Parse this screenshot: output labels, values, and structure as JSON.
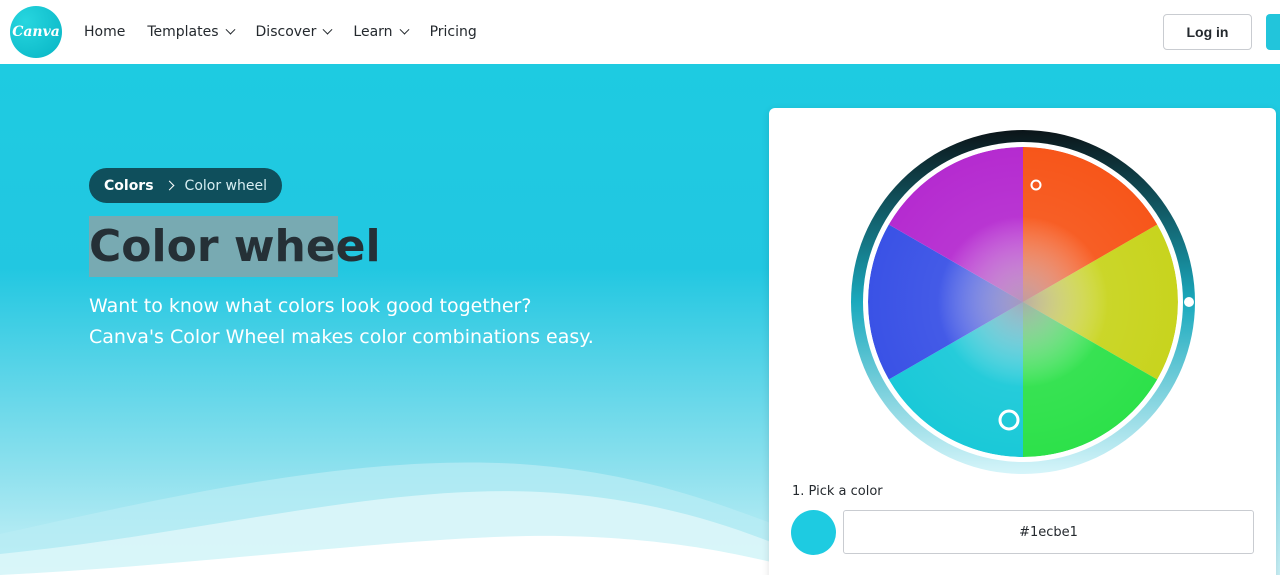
{
  "header": {
    "logo_text": "Canva",
    "nav": [
      {
        "label": "Home",
        "has_menu": false
      },
      {
        "label": "Templates",
        "has_menu": true
      },
      {
        "label": "Discover",
        "has_menu": true
      },
      {
        "label": "Learn",
        "has_menu": true
      },
      {
        "label": "Pricing",
        "has_menu": false
      }
    ],
    "login_label": "Log in"
  },
  "hero": {
    "breadcrumb": {
      "parent": "Colors",
      "current": "Color wheel"
    },
    "title": "Color wheel",
    "subtitle_line1": "Want to know what colors look good together?",
    "subtitle_line2": "Canva's Color Wheel makes color combinations easy."
  },
  "tool": {
    "pick_label": "1. Pick a color",
    "hex_value": "#1ecbe1"
  },
  "colors": {
    "brand": "#1ecbe1",
    "breadcrumb_bg": "#0f4f5c",
    "selected": "#1ecbe1"
  }
}
